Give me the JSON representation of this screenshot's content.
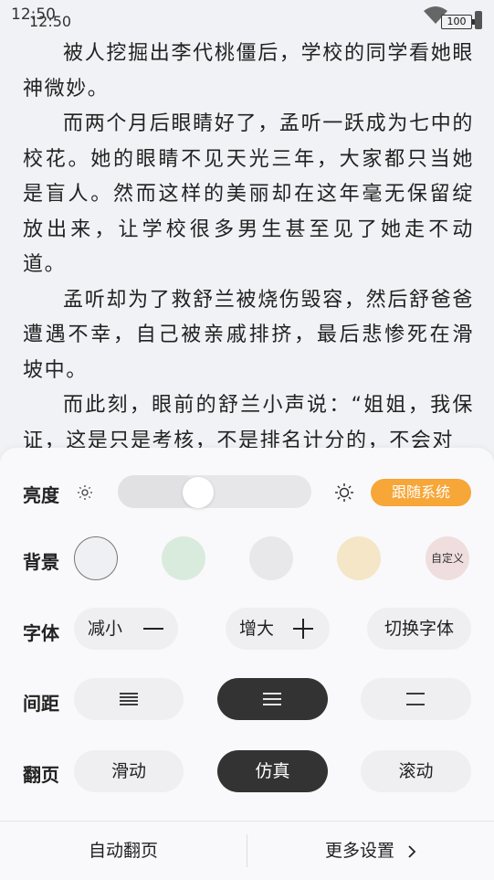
{
  "status_bar": {
    "time_primary": "12:50",
    "time_secondary": "12:50",
    "battery": "100"
  },
  "reader": {
    "paragraphs": [
      "被人挖掘出李代桃僵后，学校的同学看她眼神微妙。",
      "而两个月后眼睛好了，孟听一跃成为七中的校花。她的眼睛不见天光三年，大家都只当她是盲人。然而这样的美丽却在这年毫无保留绽放出来，让学校很多男生甚至见了她走不动道。",
      "孟听却为了救舒兰被烧伤毁容，然后舒爸爸遭遇不幸，自己被亲戚排挤，最后悲惨死在滑坡中。",
      "而此刻，眼前的舒兰小声说：“姐姐，我保证，这是只是考核，不是排名计分的，不会对"
    ]
  },
  "panel": {
    "brightness": {
      "label": "亮度",
      "level": 0.4,
      "follow_system": "跟随系统"
    },
    "background": {
      "label": "背景",
      "options": [
        {
          "name": "white",
          "color": "#eef0f4",
          "selected": true
        },
        {
          "name": "green",
          "color": "#d9ebdd"
        },
        {
          "name": "gray",
          "color": "#e8e8ea"
        },
        {
          "name": "yellow",
          "color": "#f4e6c6"
        },
        {
          "name": "custom",
          "color": "#f0dede",
          "label": "自定义"
        }
      ]
    },
    "font": {
      "label": "字体",
      "decrease": "减小",
      "increase": "增大",
      "switch": "切换字体"
    },
    "spacing": {
      "label": "间距",
      "options": [
        "compact-icon",
        "medium-icon",
        "loose-icon"
      ],
      "selected": 1
    },
    "page_turn": {
      "label": "翻页",
      "options": [
        "滑动",
        "仿真",
        "滚动"
      ],
      "selected": 1
    }
  },
  "bottom_bar": {
    "auto_page": "自动翻页",
    "more_settings": "更多设置",
    "more_icon": "chevron-right-icon"
  },
  "colors": {
    "accent": "#f7a638",
    "active_pill": "#333333",
    "page_bg": "#f1f2f6"
  }
}
